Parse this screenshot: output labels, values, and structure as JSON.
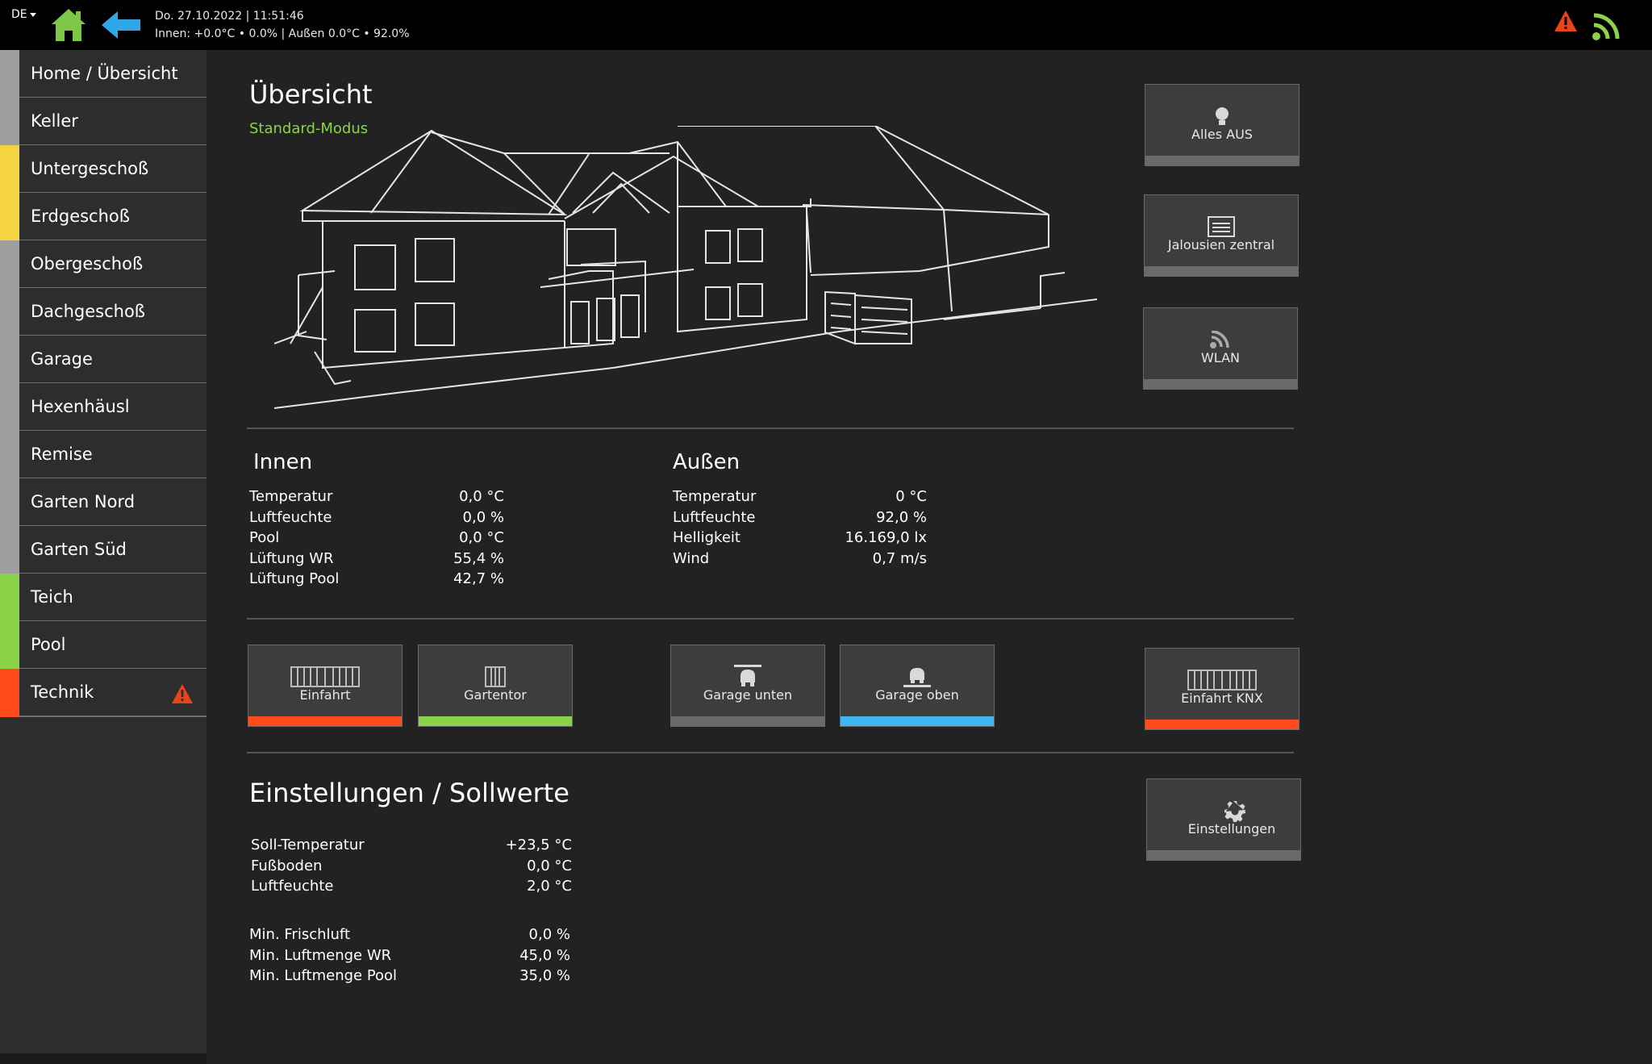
{
  "header": {
    "language": "DE",
    "datetime": "Do. 27.10.2022 | 11:51:46",
    "climate_summary": "Innen: +0.0°C • 0.0% | Außen 0.0°C • 92.0%",
    "icons": [
      "home-icon",
      "back-arrow-icon",
      "warning-icon",
      "wifi-icon"
    ],
    "colors": {
      "home": "#7cc846",
      "back": "#2ea8e8",
      "warning": "#e8441c",
      "wifi": "#8cd34a"
    }
  },
  "sidebar": {
    "items": [
      {
        "label": "Home / Übersicht",
        "color": "#9e9e9e"
      },
      {
        "label": "Keller",
        "color": "#9e9e9e"
      },
      {
        "label": "Untergeschoß",
        "color": "#f5d442"
      },
      {
        "label": "Erdgeschoß",
        "color": "#f5d442"
      },
      {
        "label": "Obergeschoß",
        "color": "#9e9e9e"
      },
      {
        "label": "Dachgeschoß",
        "color": "#9e9e9e"
      },
      {
        "label": "Garage",
        "color": "#9e9e9e"
      },
      {
        "label": "Hexenhäusl",
        "color": "#9e9e9e"
      },
      {
        "label": "Remise",
        "color": "#9e9e9e"
      },
      {
        "label": "Garten Nord",
        "color": "#9e9e9e"
      },
      {
        "label": "Garten Süd",
        "color": "#9e9e9e"
      },
      {
        "label": "Teich",
        "color": "#8cd34a"
      },
      {
        "label": "Pool",
        "color": "#8cd34a"
      },
      {
        "label": "Technik",
        "color": "#ff4a1c",
        "warning": true
      }
    ]
  },
  "overview": {
    "title": "Übersicht",
    "mode": "Standard-Modus",
    "quick_buttons": [
      {
        "label": "Alles AUS",
        "icon": "bulb-icon"
      },
      {
        "label": "Jalousien zentral",
        "icon": "blinds-icon"
      },
      {
        "label": "WLAN",
        "icon": "wifi-icon"
      }
    ]
  },
  "innen": {
    "title": "Innen",
    "rows": [
      {
        "label": "Temperatur",
        "value": "0,0 °C"
      },
      {
        "label": "Luftfeuchte",
        "value": "0,0 %"
      },
      {
        "label": "Pool",
        "value": "0,0 °C"
      },
      {
        "label": "Lüftung WR",
        "value": "55,4 %"
      },
      {
        "label": "Lüftung Pool",
        "value": "42,7 %"
      }
    ]
  },
  "aussen": {
    "title": "Außen",
    "rows": [
      {
        "label": "Temperatur",
        "value": "0 °C"
      },
      {
        "label": "Luftfeuchte",
        "value": "92,0 %"
      },
      {
        "label": "Helligkeit",
        "value": "16.169,0 lx"
      },
      {
        "label": "Wind",
        "value": "0,7 m/s"
      }
    ]
  },
  "gates": [
    {
      "label": "Einfahrt",
      "icon": "gate-icon",
      "status_color": "#ff4a1c"
    },
    {
      "label": "Gartentor",
      "icon": "garden-gate-icon",
      "status_color": "#8cd34a"
    },
    {
      "label": "Garage unten",
      "icon": "garage-door-icon",
      "status_color": "#6a6a6a"
    },
    {
      "label": "Garage oben",
      "icon": "garage-door-icon",
      "status_color": "#3fb6f0"
    },
    {
      "label": "Einfahrt KNX",
      "icon": "gate-icon",
      "status_color": "#ff4a1c"
    }
  ],
  "settings": {
    "title": "Einstellungen / Sollwerte",
    "rows_a": [
      {
        "label": "Soll-Temperatur",
        "value": "+23,5 °C"
      },
      {
        "label": "Fußboden",
        "value": "0,0 °C"
      },
      {
        "label": "Luftfeuchte",
        "value": "2,0 °C"
      }
    ],
    "rows_b": [
      {
        "label": "Min. Frischluft",
        "value": "0,0 %"
      },
      {
        "label": "Min. Luftmenge WR",
        "value": "45,0 %"
      },
      {
        "label": "Min. Luftmenge Pool",
        "value": "35,0 %"
      }
    ],
    "button": {
      "label": "Einstellungen",
      "icon": "gear-icon"
    }
  }
}
